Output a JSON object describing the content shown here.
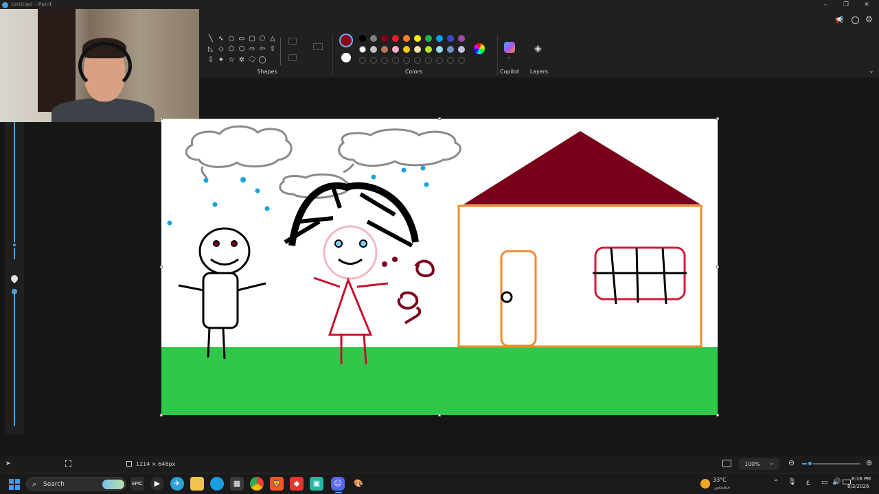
{
  "window": {
    "title": "Untitled - Paint",
    "controls": [
      "–",
      "❐",
      "✕"
    ]
  },
  "ribbon": {
    "shapes_label": "Shapes",
    "colors_label": "Colors",
    "copilot_label": "Copilot",
    "layers_label": "Layers",
    "shape_glyphs": [
      "╲",
      "∿",
      "○",
      "▭",
      "▢",
      "⬠",
      "△",
      "◺",
      "◇",
      "⬠",
      "⬡",
      "⇨",
      "⇦",
      "⇧",
      "⇩",
      "✦",
      "☆",
      "✲",
      "🗨",
      "◯"
    ],
    "swatches_row1": [
      "#000000",
      "#7f7f7f",
      "#880015",
      "#ed1c24",
      "#ff7f27",
      "#fff200",
      "#22b14c",
      "#00a2e8",
      "#3f48cc",
      "#a349a4"
    ],
    "swatches_row2": [
      "#ffffff",
      "#c3c3c3",
      "#b97a57",
      "#ffaec9",
      "#ffc90e",
      "#efe4b0",
      "#b5e61d",
      "#99d9ea",
      "#7092be",
      "#c8bfe7"
    ],
    "primary_color": "#880015",
    "secondary_color": "#ffffff"
  },
  "canvas": {
    "background": "#ffffff",
    "grass_color": "#2ec84a",
    "roof_color": "#7a0019",
    "house_outline": "#f08a2a",
    "window_outline": "#d11a3a",
    "rain_color": "#1aa3d9",
    "scribble_text": "حلقي"
  },
  "status": {
    "canvas_size": "1214 × 648px",
    "zoom": "100%"
  },
  "taskbar": {
    "search_placeholder": "Search",
    "weather_temp": "33°C",
    "weather_desc": "مشمس",
    "lang": "ع",
    "time": "8:16 PM",
    "date": "8/3/2026"
  }
}
